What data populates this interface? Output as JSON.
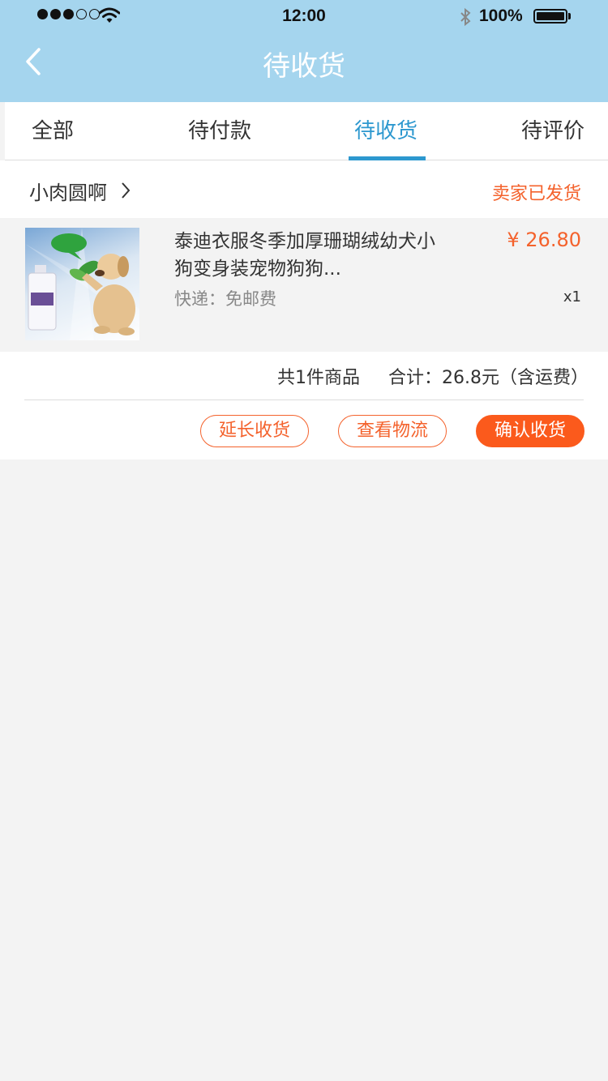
{
  "status_bar": {
    "time": "12:00",
    "battery": "100%"
  },
  "header": {
    "title": "待收货"
  },
  "tabs": [
    {
      "label": "全部"
    },
    {
      "label": "待付款"
    },
    {
      "label": "待收货",
      "active": true
    },
    {
      "label": "待评价"
    }
  ],
  "order": {
    "shop_name": "小肉圆啊",
    "status": "卖家已发货",
    "product": {
      "title": "泰迪衣服冬季加厚珊瑚绒幼犬小狗变身装宠物狗狗...",
      "shipping": "快递：免邮费",
      "price": "¥ 26.80",
      "quantity": "x1"
    },
    "summary": {
      "count": "共1件商品",
      "total": "合计：26.8元（含运费）"
    },
    "actions": {
      "extend": "延长收货",
      "logistics": "查看物流",
      "confirm": "确认收货"
    }
  },
  "colors": {
    "header_bg": "#a5d5ee",
    "tab_active": "#2d98cf",
    "accent": "#f4622c",
    "confirm_bg": "#fb5a1c"
  }
}
